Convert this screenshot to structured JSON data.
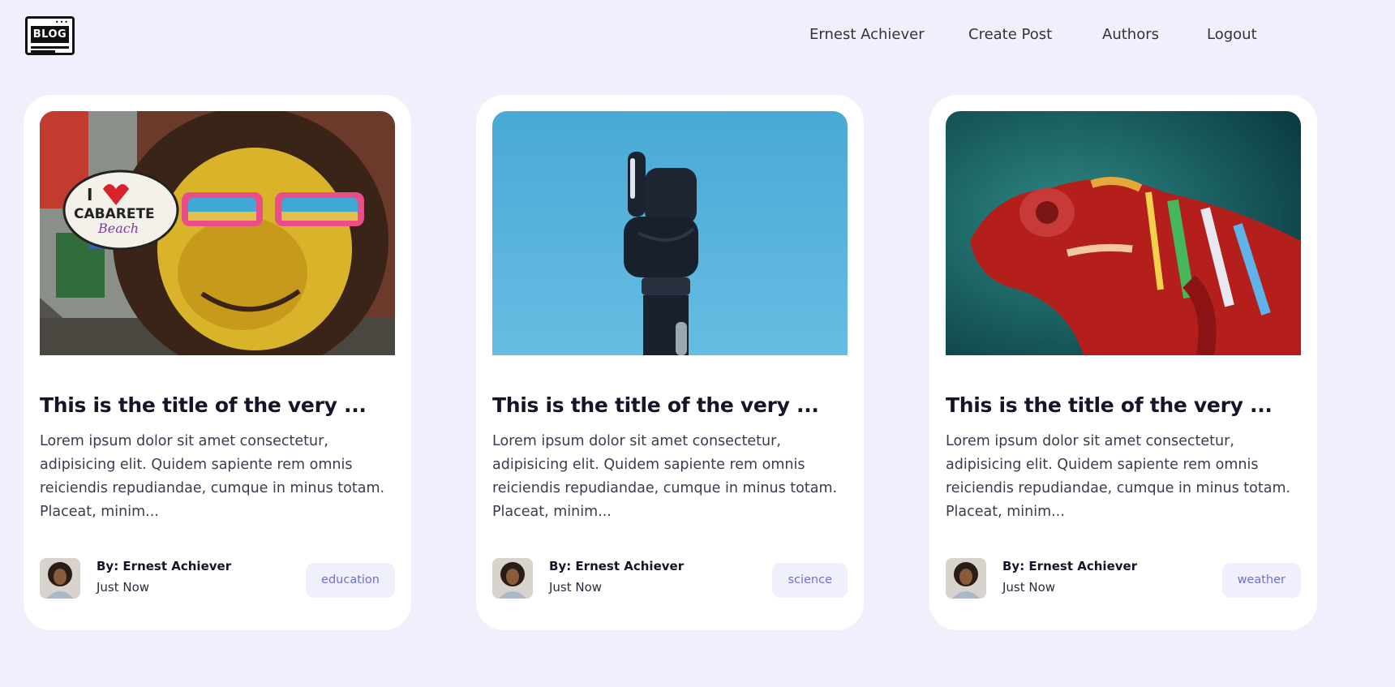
{
  "brand": {
    "logo_text": "BLOG",
    "logo_dots": "•••"
  },
  "nav": {
    "items": [
      {
        "label": "Ernest Achiever"
      },
      {
        "label": "Create Post"
      },
      {
        "label": "Authors"
      },
      {
        "label": "Logout"
      }
    ]
  },
  "posts": [
    {
      "image": "graffiti-mural",
      "title": "This is the title of the very ...",
      "excerpt": "Lorem ipsum dolor sit amet consectetur, adipisicing elit. Quidem sapiente rem omnis reiciendis repudiandae, cumque in minus totam. Placeat, minim...",
      "author": "By: Ernest Achiever",
      "time": "Just Now",
      "category": "education"
    },
    {
      "image": "robotic-hand",
      "title": "This is the title of the very ...",
      "excerpt": "Lorem ipsum dolor sit amet consectetur, adipisicing elit. Quidem sapiente rem omnis reiciendis repudiandae, cumque in minus totam. Placeat, minim...",
      "author": "By: Ernest Achiever",
      "time": "Just Now",
      "category": "science"
    },
    {
      "image": "chameleon",
      "title": "This is the title of the very ...",
      "excerpt": "Lorem ipsum dolor sit amet consectetur, adipisicing elit. Quidem sapiente rem omnis reiciendis repudiandae, cumque in minus totam. Placeat, minim...",
      "author": "By: Ernest Achiever",
      "time": "Just Now",
      "category": "weather"
    }
  ],
  "colors": {
    "page_bg": "#f0f0fd",
    "card_bg": "#ffffff",
    "tag_bg": "#f0f0fd",
    "tag_text": "#6f6fce",
    "title_text": "#15152a"
  }
}
